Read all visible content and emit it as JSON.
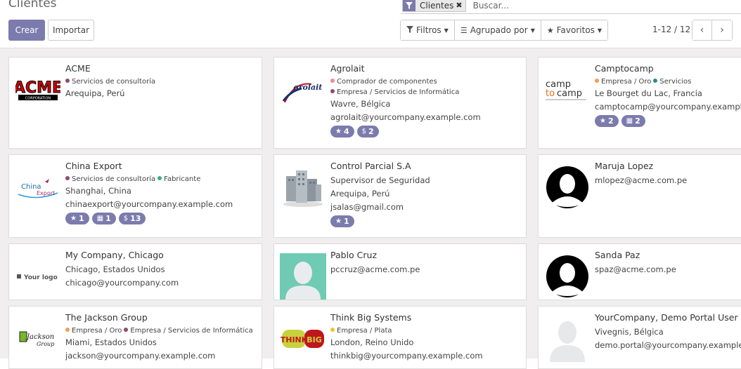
{
  "header": {
    "title": "Clientes"
  },
  "search": {
    "facet_label": "Clientes",
    "facet_icon": "filter-icon",
    "placeholder": "Buscar..."
  },
  "toolbar": {
    "create_label": "Crear",
    "import_label": "Importar",
    "filters_label": "Filtros",
    "groupby_label": "Agrupado por",
    "favorites_label": "Favoritos"
  },
  "pager": {
    "value": "1-12 / 12",
    "prev_icon": "chevron-left-icon",
    "next_icon": "chevron-right-icon"
  },
  "colors": {
    "accent": "#7c7bad"
  },
  "cards": [
    {
      "name": "ACME",
      "logo": "acme-logo",
      "logo_text": "ACME CORPORATION",
      "tags": [
        {
          "label": "Servicios de consultoría",
          "color": "#8e4b6e"
        }
      ],
      "lines": [
        "Arequipa, Perú"
      ],
      "badges": []
    },
    {
      "name": "Agrolait",
      "logo": "agrolait-logo",
      "logo_text": "Agrolait",
      "tags": [
        {
          "label": "Comprador de componentes",
          "color": "#f08c8c"
        },
        {
          "label": "Empresa / Servicios de Informática",
          "color": "#8e4b6e"
        }
      ],
      "lines": [
        "Wavre, Bélgica",
        "agrolait@yourcompany.example.com"
      ],
      "badges": [
        {
          "icon": "star-icon",
          "glyph": "★",
          "value": "4"
        },
        {
          "icon": "dollar-icon",
          "glyph": "$",
          "value": "2"
        }
      ]
    },
    {
      "name": "Camptocamp",
      "logo": "camptocamp-logo",
      "logo_text": "camptocamp",
      "tags": [
        {
          "label": "Empresa / Oro",
          "color": "#f0a050"
        },
        {
          "label": "Servicios",
          "color": "#2e8b8b"
        }
      ],
      "lines": [
        "Le Bourget du Lac, Francia",
        "camptocamp@yourcompany.example.com"
      ],
      "badges": [
        {
          "icon": "star-icon",
          "glyph": "★",
          "value": "2"
        },
        {
          "icon": "calendar-icon",
          "glyph": "▦",
          "value": "2"
        }
      ]
    },
    {
      "name": "China Export",
      "logo": "chinaexport-logo",
      "logo_text": "China Export",
      "tags": [
        {
          "label": "Servicios de consultoría",
          "color": "#8e4b6e"
        },
        {
          "label": "Fabricante",
          "color": "#3cb07a"
        }
      ],
      "lines": [
        "Shanghai, China",
        "chinaexport@yourcompany.example.com"
      ],
      "badges": [
        {
          "icon": "star-icon",
          "glyph": "★",
          "value": "1"
        },
        {
          "icon": "calendar-icon",
          "glyph": "▦",
          "value": "1"
        },
        {
          "icon": "dollar-icon",
          "glyph": "$",
          "value": "13"
        }
      ]
    },
    {
      "name": "Control Parcial S.A",
      "logo": "buildings-image",
      "logo_text": "",
      "tags": [],
      "lines": [
        "Supervisor de Seguridad",
        "Arequipa, Perú",
        "jsalas@gmail.com"
      ],
      "badges": [
        {
          "icon": "star-icon",
          "glyph": "★",
          "value": "1"
        }
      ]
    },
    {
      "name": "Maruja Lopez",
      "logo": "avatar-silhouette",
      "logo_text": "",
      "tags": [],
      "lines": [
        "mlopez@acme.com.pe"
      ],
      "badges": []
    },
    {
      "name": "My Company, Chicago",
      "logo": "yourlogo-logo",
      "logo_text": "Your logo",
      "tags": [],
      "lines": [
        "Chicago, Estados Unidos",
        "chicago@yourcompany.com"
      ],
      "badges": []
    },
    {
      "name": "Pablo Cruz",
      "logo": "avatar-placeholder",
      "logo_text": "",
      "tags": [],
      "lines": [
        "pccruz@acme.com.pe"
      ],
      "badges": []
    },
    {
      "name": "Sanda Paz",
      "logo": "avatar-silhouette",
      "logo_text": "",
      "tags": [],
      "lines": [
        "spaz@acme.com.pe"
      ],
      "badges": []
    },
    {
      "name": "The Jackson Group",
      "logo": "jackson-logo",
      "logo_text": "Jackson Group",
      "tags": [
        {
          "label": "Empresa / Oro",
          "color": "#f0a050"
        },
        {
          "label": "Empresa / Servicios de Informática",
          "color": "#8e4b6e"
        }
      ],
      "lines": [
        "Miami, Estados Unidos",
        "jackson@yourcompany.example.com"
      ],
      "badges": []
    },
    {
      "name": "Think Big Systems",
      "logo": "thinkbig-logo",
      "logo_text": "THINK BIG",
      "tags": [
        {
          "label": "Empresa / Plata",
          "color": "#e8c830"
        }
      ],
      "lines": [
        "London, Reino Unido",
        "thinkbig@yourcompany.example.com"
      ],
      "badges": []
    },
    {
      "name": "YourCompany, Demo Portal User",
      "logo": "avatar-placeholder-white",
      "logo_text": "",
      "tags": [],
      "lines": [
        "Vivegnis, Bélgica",
        "demo.portal@yourcompany.example.com"
      ],
      "badges": []
    }
  ]
}
